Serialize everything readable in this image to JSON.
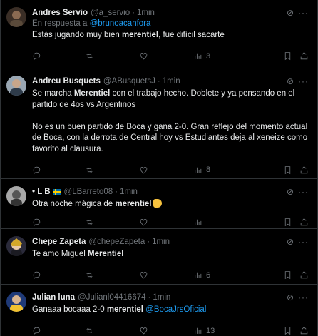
{
  "tweets": [
    {
      "name": "Andres Servio",
      "handle": "@a_servio",
      "dot": "·",
      "time": "1min",
      "reply_prefix": "En respuesta a",
      "reply_handle": "@brunoacanfora",
      "text_parts": [
        "Estás jugando muy bien ",
        "merentiel",
        ", fue difícil sacarte"
      ],
      "views": "3",
      "avatar_color": "#5a4a3a"
    },
    {
      "name": "Andreu Busquets",
      "handle": "@ABusquetsJ",
      "dot": "·",
      "time": "1min",
      "text_parts": [
        "Se marcha ",
        "Merentiel",
        " con el trabajo hecho. Doblete y ya pensando en el partido de 4os vs Argentinos\n\nNo es un buen partido de Boca y gana 2-0. Gran reflejo del momento actual de Boca, con la derrota de Central hoy vs Estudiantes deja al xeneize como favorito al clausura."
      ],
      "views": "8",
      "avatar_color": "#6b7a8a"
    },
    {
      "name": "• L B",
      "handle": "@LBarreto08",
      "dot": "·",
      "time": "1min",
      "text_parts": [
        "Otra noche mágica de ",
        "merentiel",
        ""
      ],
      "views": "",
      "avatar_color": "#8a8a8a"
    },
    {
      "name": "Chepe Zapeta",
      "handle": "@chepeZapeta",
      "dot": "·",
      "time": "1min",
      "text_parts": [
        "Te amo Miguel ",
        "Merentiel",
        ""
      ],
      "views": "6",
      "avatar_color": "#c9a227"
    },
    {
      "name": "Julian luna",
      "handle": "@Julianl04416674",
      "dot": "·",
      "time": "1min",
      "text_parts": [
        "Ganaaa bocaaa 2-0 ",
        "merentiel",
        " "
      ],
      "mention": "@BocaJrsOficial",
      "views": "13",
      "avatar_color": "#1f3a78"
    }
  ],
  "icons": {
    "reply": "reply-icon",
    "retweet": "retweet-icon",
    "like": "heart-icon",
    "views": "views-icon",
    "bookmark": "bookmark-icon",
    "share": "share-icon",
    "grok": "grok-icon",
    "more": "more-icon"
  },
  "colors": {
    "background": "#000000",
    "text": "#e7e9ea",
    "muted": "#71767b",
    "link": "#1d9bf0",
    "border": "#2f3336"
  }
}
